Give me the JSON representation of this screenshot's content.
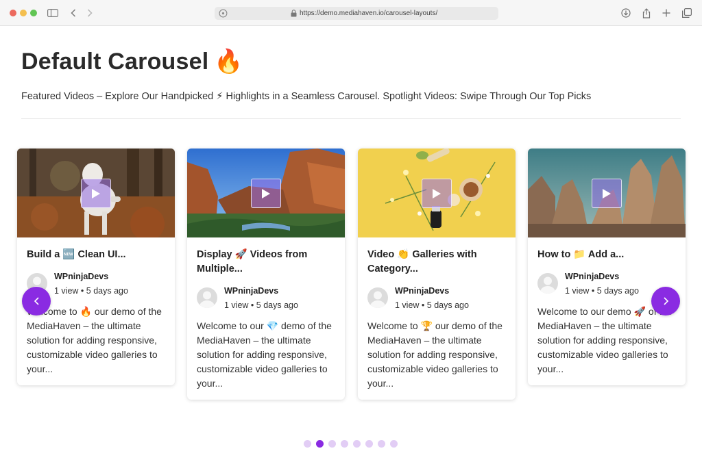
{
  "browser": {
    "url": "https://demo.mediahaven.io/carousel-layouts/"
  },
  "page": {
    "title": "Default Carousel",
    "title_emoji": "🔥",
    "subtitle": "Featured Videos – Explore Our Handpicked ⚡ Highlights in a Seamless Carousel. Spotlight Videos: Swipe Through Our Top Picks"
  },
  "cards": [
    {
      "title": "Build a 🆕 Clean UI...",
      "author": "WPninjaDevs",
      "views": "1 view",
      "age": "5 days ago",
      "excerpt": "Welcome to 🔥 our demo of the MediaHaven – the ultimate solution for adding responsive, customizable video galleries to your...",
      "thumbnail": "white-wolf-in-autumn-forest"
    },
    {
      "title": "Display 🚀 Videos from Multiple...",
      "author": "WPninjaDevs",
      "views": "1 view",
      "age": "5 days ago",
      "excerpt": "Welcome to our 💎 demo of the MediaHaven – the ultimate solution for adding responsive, customizable video galleries to your...",
      "thumbnail": "canyon-cliffs-blue-sky"
    },
    {
      "title": "Video 👏 Galleries with Category...",
      "author": "WPninjaDevs",
      "views": "1 view",
      "age": "5 days ago",
      "excerpt": "Welcome to 🏆 our demo of the MediaHaven – the ultimate solution for adding responsive, customizable video galleries to your...",
      "thumbnail": "flowers-and-jars-on-yellow"
    },
    {
      "title": "How to 📁 Add a...",
      "author": "WPninjaDevs",
      "views": "1 view",
      "age": "5 days ago",
      "excerpt": "Welcome to our demo 🚀 of the MediaHaven – the ultimate solution for adding responsive, customizable video galleries to your...",
      "thumbnail": "rock-spires-landscape"
    }
  ],
  "pagination": {
    "total": 8,
    "active_index": 1
  },
  "colors": {
    "accent": "#8a2be2",
    "dot_inactive": "#e2cdf5"
  }
}
